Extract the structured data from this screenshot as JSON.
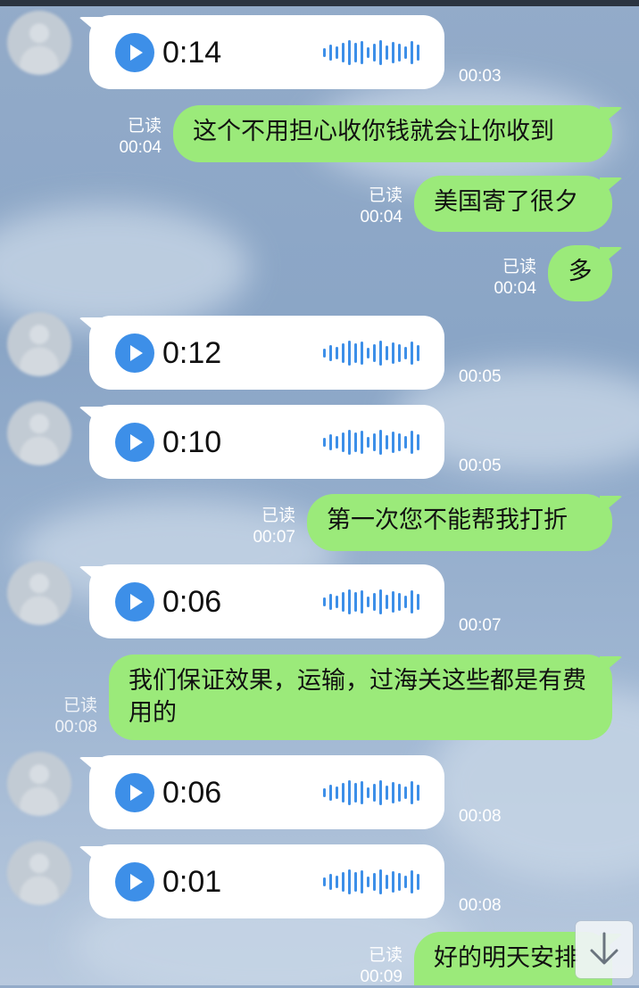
{
  "colors": {
    "sent_bubble": "#9bea7a",
    "received_bubble": "#ffffff",
    "play_button": "#3d8fe8",
    "waveform": "#3d8fe8",
    "meta_text": "#ffffff"
  },
  "messages": [
    {
      "type": "voice",
      "duration": "0:14",
      "time": "00:03"
    },
    {
      "type": "text",
      "text": "这个不用担心收你钱就会让你收到",
      "read": "已读",
      "time": "00:04"
    },
    {
      "type": "text",
      "text": "美国寄了很夕",
      "read": "已读",
      "time": "00:04"
    },
    {
      "type": "text",
      "text": "多",
      "read": "已读",
      "time": "00:04"
    },
    {
      "type": "voice",
      "duration": "0:12",
      "time": "00:05"
    },
    {
      "type": "voice",
      "duration": "0:10",
      "time": "00:05"
    },
    {
      "type": "text",
      "text": "第一次您不能帮我打折",
      "read": "已读",
      "time": "00:07"
    },
    {
      "type": "voice",
      "duration": "0:06",
      "time": "00:07"
    },
    {
      "type": "text",
      "text": "我们保证效果，运输，过海关这些都是有费用的",
      "read": "已读",
      "time": "00:08"
    },
    {
      "type": "voice",
      "duration": "0:06",
      "time": "00:08"
    },
    {
      "type": "voice",
      "duration": "0:01",
      "time": "00:08"
    },
    {
      "type": "text",
      "text": "好的明天安排",
      "read": "已读",
      "time": "00:09"
    }
  ],
  "icons": {
    "play": "play-icon",
    "waveform": "waveform-icon",
    "scroll_down": "arrow-down-icon",
    "avatar": "avatar-blurred"
  }
}
